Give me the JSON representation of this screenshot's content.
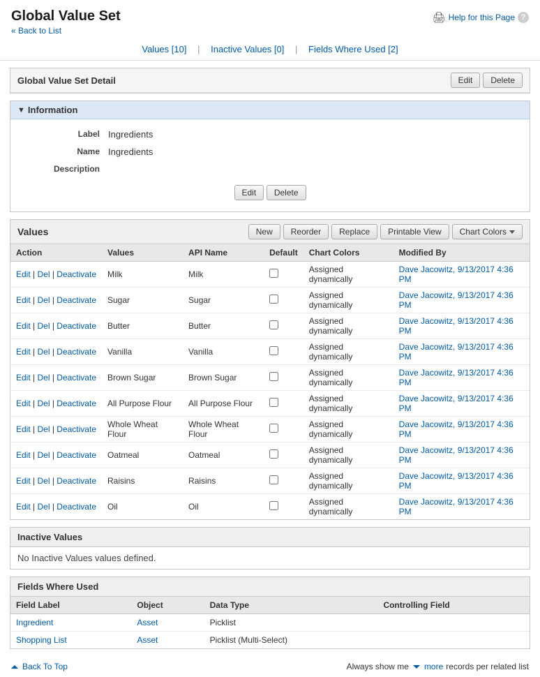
{
  "page": {
    "title": "Global Value Set",
    "back_link": "« Back to List",
    "help_link": "Help for this Page"
  },
  "tabs": {
    "values": "Values [10]",
    "inactive_values": "Inactive Values [0]",
    "fields_where_used": "Fields Where Used [2]"
  },
  "detail_section": {
    "title": "Global Value Set Detail",
    "edit_btn": "Edit",
    "delete_btn": "Delete"
  },
  "information": {
    "header": "Information",
    "label_field": "Label",
    "label_value": "Ingredients",
    "name_field": "Name",
    "name_value": "Ingredients",
    "description_field": "Description",
    "description_value": "",
    "edit_btn": "Edit",
    "delete_btn": "Delete"
  },
  "values_section": {
    "title": "Values",
    "new_btn": "New",
    "reorder_btn": "Reorder",
    "replace_btn": "Replace",
    "printable_view_btn": "Printable View",
    "chart_colors_btn": "Chart Colors",
    "col_action": "Action",
    "col_values": "Values",
    "col_api_name": "API Name",
    "col_default": "Default",
    "col_chart_colors": "Chart Colors",
    "col_modified_by": "Modified By",
    "rows": [
      {
        "values": "Milk",
        "api_name": "Milk",
        "chart_colors": "Assigned dynamically",
        "modified_by": "Dave Jacowitz, 9/13/2017 4:36 PM"
      },
      {
        "values": "Sugar",
        "api_name": "Sugar",
        "chart_colors": "Assigned dynamically",
        "modified_by": "Dave Jacowitz, 9/13/2017 4:36 PM"
      },
      {
        "values": "Butter",
        "api_name": "Butter",
        "chart_colors": "Assigned dynamically",
        "modified_by": "Dave Jacowitz, 9/13/2017 4:36 PM"
      },
      {
        "values": "Vanilla",
        "api_name": "Vanilla",
        "chart_colors": "Assigned dynamically",
        "modified_by": "Dave Jacowitz, 9/13/2017 4:36 PM"
      },
      {
        "values": "Brown Sugar",
        "api_name": "Brown Sugar",
        "chart_colors": "Assigned dynamically",
        "modified_by": "Dave Jacowitz, 9/13/2017 4:36 PM"
      },
      {
        "values": "All Purpose Flour",
        "api_name": "All Purpose Flour",
        "chart_colors": "Assigned dynamically",
        "modified_by": "Dave Jacowitz, 9/13/2017 4:36 PM"
      },
      {
        "values": "Whole Wheat Flour",
        "api_name": "Whole Wheat Flour",
        "chart_colors": "Assigned dynamically",
        "modified_by": "Dave Jacowitz, 9/13/2017 4:36 PM"
      },
      {
        "values": "Oatmeal",
        "api_name": "Oatmeal",
        "chart_colors": "Assigned dynamically",
        "modified_by": "Dave Jacowitz, 9/13/2017 4:36 PM"
      },
      {
        "values": "Raisins",
        "api_name": "Raisins",
        "chart_colors": "Assigned dynamically",
        "modified_by": "Dave Jacowitz, 9/13/2017 4:36 PM"
      },
      {
        "values": "Oil",
        "api_name": "Oil",
        "chart_colors": "Assigned dynamically",
        "modified_by": "Dave Jacowitz, 9/13/2017 4:36 PM"
      }
    ],
    "action_edit": "Edit",
    "action_del": "Del",
    "action_deactivate": "Deactivate"
  },
  "inactive_section": {
    "title": "Inactive Values",
    "no_values_msg": "No Inactive Values values defined."
  },
  "fields_section": {
    "title": "Fields Where Used",
    "col_field_label": "Field Label",
    "col_object": "Object",
    "col_data_type": "Data Type",
    "col_controlling_field": "Controlling Field",
    "rows": [
      {
        "field_label": "Ingredient",
        "object": "Asset",
        "data_type": "Picklist",
        "controlling_field": ""
      },
      {
        "field_label": "Shopping List",
        "object": "Asset",
        "data_type": "Picklist (Multi-Select)",
        "controlling_field": ""
      }
    ]
  },
  "footer": {
    "back_to_top": "Back To Top",
    "always_show": "Always show me",
    "more": "more",
    "records_per_list": "records per related list"
  }
}
